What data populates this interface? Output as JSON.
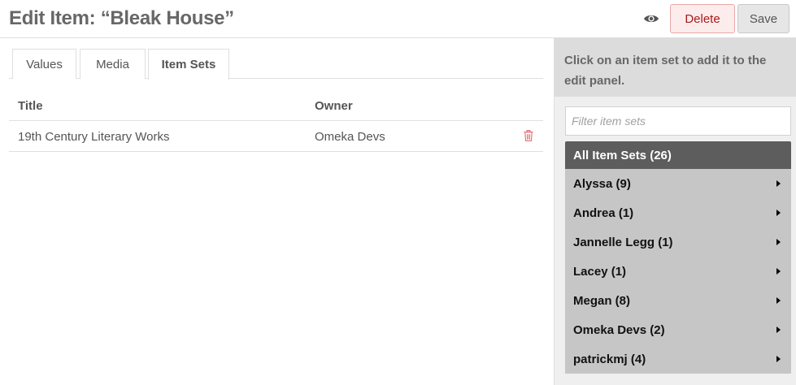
{
  "header": {
    "title": "Edit Item: “Bleak House”",
    "view_icon": "eye-icon",
    "delete_label": "Delete",
    "save_label": "Save"
  },
  "tabs": [
    {
      "label": "Values",
      "active": false
    },
    {
      "label": "Media",
      "active": false
    },
    {
      "label": "Item Sets",
      "active": true
    }
  ],
  "table": {
    "columns": [
      "Title",
      "Owner"
    ],
    "rows": [
      {
        "title": "19th Century Literary Works",
        "owner": "Omeka Devs",
        "action_icon": "trash-icon"
      }
    ]
  },
  "sidebar": {
    "instructions": "Click on an item set to add it to the edit panel.",
    "filter_placeholder": "Filter item sets",
    "all_sets_label": "All Item Sets (26)",
    "owners": [
      {
        "label": "Alyssa (9)"
      },
      {
        "label": "Andrea (1)"
      },
      {
        "label": "Jannelle Legg (1)"
      },
      {
        "label": "Lacey (1)"
      },
      {
        "label": "Megan (8)"
      },
      {
        "label": "Omeka Devs (2)"
      },
      {
        "label": "patrickmj (4)"
      }
    ]
  },
  "colors": {
    "delete_text": "#a91919",
    "delete_bg": "#fcecec",
    "all_sets_bg": "#5d5d5d",
    "owner_bg": "#c6c6c6",
    "trash": "#e07070"
  }
}
